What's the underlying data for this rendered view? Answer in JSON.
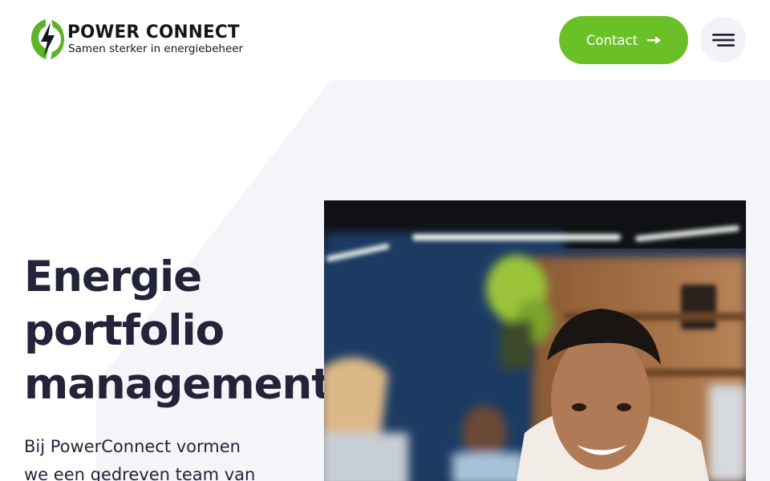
{
  "brand": {
    "name": "POWER CONNECT",
    "tagline": "Samen sterker in energiebeheer",
    "logo_icon": "lightning-bolt-leaf-icon"
  },
  "header": {
    "contact_label": "Contact",
    "contact_icon": "arrow-right-icon",
    "menu_icon": "hamburger-menu-icon"
  },
  "hero": {
    "title_lines": [
      "Energie",
      "portfolio",
      "management"
    ],
    "intro_lines": [
      "Bij PowerConnect vormen",
      "we een gedreven team van"
    ],
    "image_semantic": "team-photo"
  },
  "colors": {
    "accent": "#6ac026",
    "text": "#23243a",
    "menu_bg": "#f2f3f6",
    "background_shape": "#f4f5f8"
  }
}
